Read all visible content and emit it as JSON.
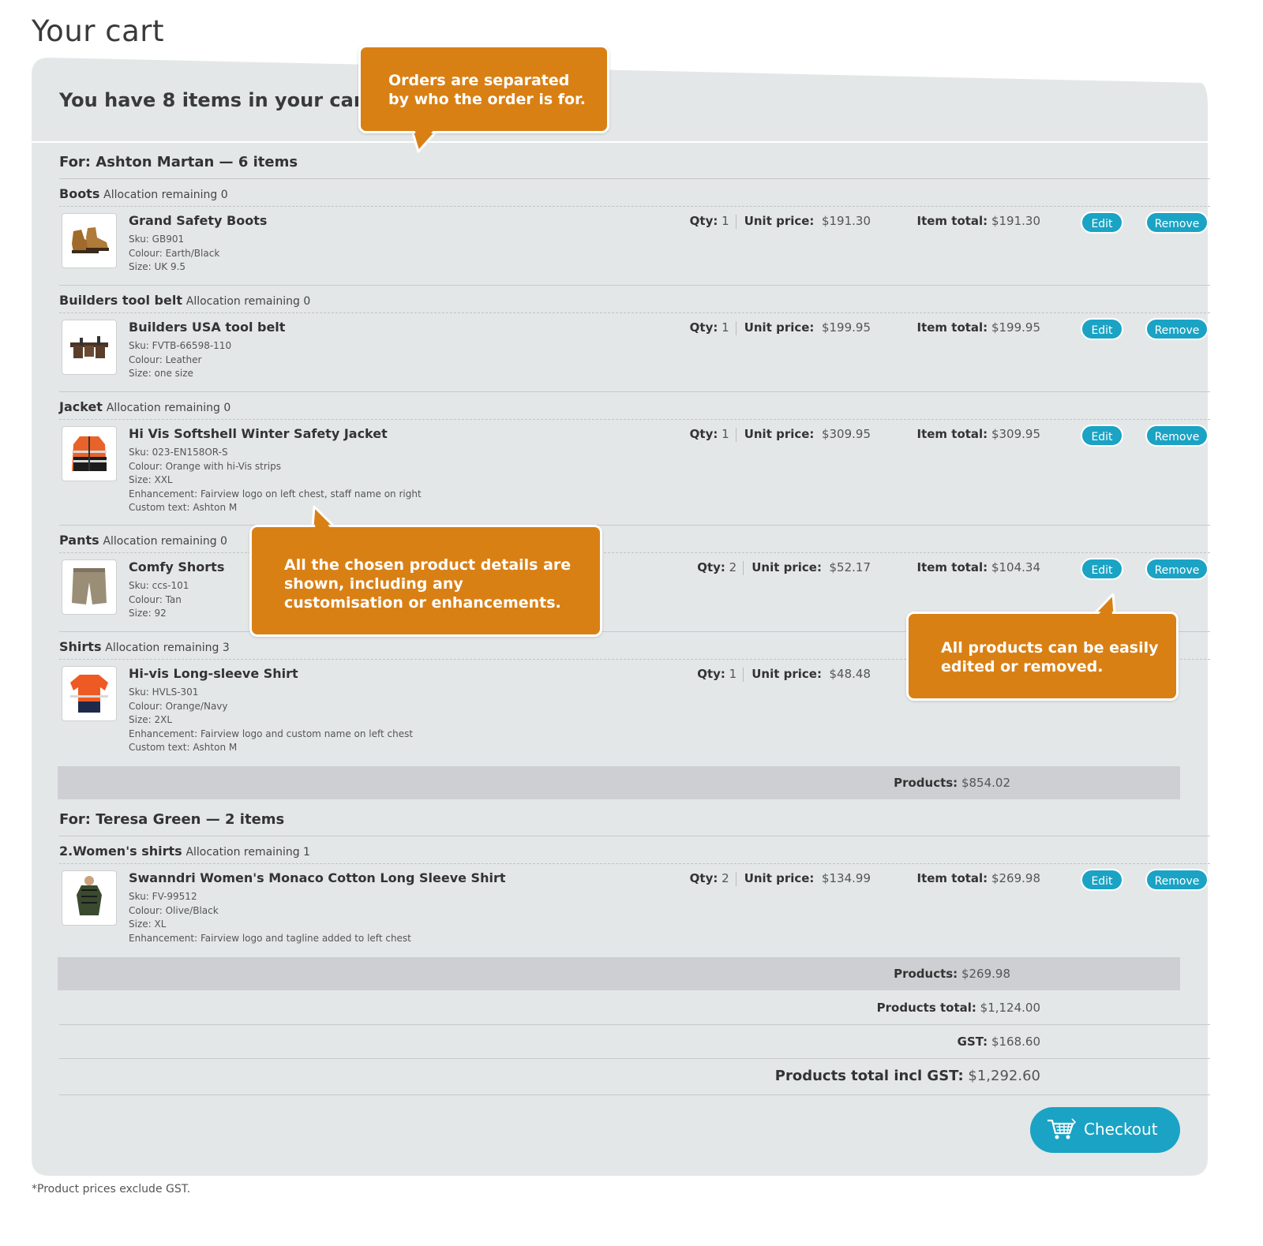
{
  "page": {
    "title": "Your cart"
  },
  "cart": {
    "count_text": "You have 8 items in your cart",
    "groups": [
      {
        "title": "For: Ashton Martan — 6 items",
        "categories": [
          {
            "name": "Boots",
            "allocation": "Allocation remaining 0",
            "item": {
              "name": "Grand Safety Boots",
              "sku": "Sku: GB901",
              "colour": "Colour: Earth/Black",
              "size": "Size: UK 9.5",
              "qty_label": "Qty:",
              "qty": "1",
              "unit_label": "Unit price:",
              "unit": "$191.30",
              "total_label": "Item total:",
              "total": "$191.30"
            }
          },
          {
            "name": "Builders tool belt",
            "allocation": "Allocation remaining 0",
            "item": {
              "name": "Builders USA tool belt",
              "sku": "Sku: FVTB-66598-110",
              "colour": "Colour: Leather",
              "size": "Size: one size",
              "qty_label": "Qty:",
              "qty": "1",
              "unit_label": "Unit price:",
              "unit": "$199.95",
              "total_label": "Item total:",
              "total": "$199.95"
            }
          },
          {
            "name": "Jacket",
            "allocation": "Allocation remaining 0",
            "item": {
              "name": "Hi Vis Softshell Winter Safety Jacket",
              "sku": "Sku: 023-EN158OR-S",
              "colour": "Colour: Orange with hi-Vis strips",
              "size": "Size: XXL",
              "enhancement": "Enhancement: Fairview logo on left chest, staff name on right",
              "custom": "Custom text: Ashton M",
              "qty_label": "Qty:",
              "qty": "1",
              "unit_label": "Unit price:",
              "unit": "$309.95",
              "total_label": "Item total:",
              "total": "$309.95"
            }
          },
          {
            "name": "Pants",
            "allocation": "Allocation remaining 0",
            "item": {
              "name": "Comfy Shorts",
              "sku": "Sku: ccs-101",
              "colour": "Colour: Tan",
              "size": "Size: 92",
              "qty_label": "Qty:",
              "qty": "2",
              "unit_label": "Unit price:",
              "unit": "$52.17",
              "total_label": "Item total:",
              "total": "$104.34"
            }
          },
          {
            "name": "Shirts",
            "allocation": "Allocation remaining 3",
            "item": {
              "name": "Hi-vis Long-sleeve Shirt",
              "sku": "Sku: HVLS-301",
              "colour": "Colour: Orange/Navy",
              "size": "Size: 2XL",
              "enhancement": "Enhancement: Fairview logo and custom name on left chest",
              "custom": "Custom text: Ashton M",
              "qty_label": "Qty:",
              "qty": "1",
              "unit_label": "Unit price:",
              "unit": "$48.48"
            }
          }
        ],
        "subtotal_label": "Products:",
        "subtotal": "$854.02"
      },
      {
        "title": "For: Teresa Green — 2 items",
        "categories": [
          {
            "name": "2.Women's shirts",
            "allocation": "Allocation remaining 1",
            "item": {
              "name": "Swanndri Women's Monaco Cotton Long Sleeve Shirt",
              "sku": "Sku: FV-99512",
              "colour": "Colour: Olive/Black",
              "size": "Size: XL",
              "enhancement": "Enhancement: Fairview logo and tagline added to left chest",
              "qty_label": "Qty:",
              "qty": "2",
              "unit_label": "Unit price:",
              "unit": "$134.99",
              "total_label": "Item total:",
              "total": "$269.98"
            }
          }
        ],
        "subtotal_label": "Products:",
        "subtotal": "$269.98"
      }
    ],
    "buttons": {
      "edit": "Edit",
      "remove": "Remove"
    },
    "totals": {
      "products_total_label": "Products total:",
      "products_total": "$1,124.00",
      "gst_label": "GST:",
      "gst": "$168.60",
      "incl_gst_label": "Products total incl GST:",
      "incl_gst": "$1,292.60"
    },
    "checkout": {
      "label": "Checkout",
      "icon": "shopping-cart-icon"
    },
    "footnote": "*Product prices exclude GST."
  },
  "callouts": {
    "orders": "Orders are separated by who the order is for.",
    "details": "All the chosen product details are shown, including any customisation or enhancements.",
    "edit": "All products can be easily edited or removed."
  },
  "colors": {
    "accent": "#1aa3c4",
    "callout": "#d98015",
    "panel": "#e4e7e8",
    "subtotal_bar": "#cdcfd2"
  }
}
